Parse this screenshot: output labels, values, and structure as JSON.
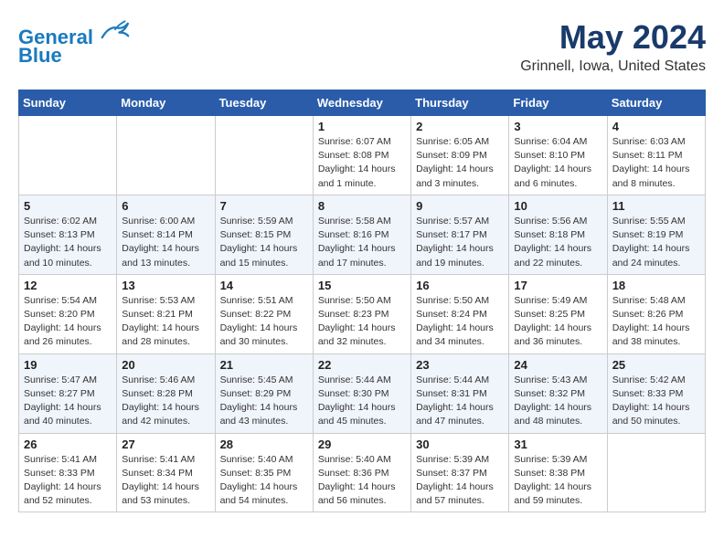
{
  "header": {
    "logo_line1": "General",
    "logo_line2": "Blue",
    "month_year": "May 2024",
    "location": "Grinnell, Iowa, United States"
  },
  "weekdays": [
    "Sunday",
    "Monday",
    "Tuesday",
    "Wednesday",
    "Thursday",
    "Friday",
    "Saturday"
  ],
  "weeks": [
    [
      {
        "day": "",
        "info": ""
      },
      {
        "day": "",
        "info": ""
      },
      {
        "day": "",
        "info": ""
      },
      {
        "day": "1",
        "info": "Sunrise: 6:07 AM\nSunset: 8:08 PM\nDaylight: 14 hours\nand 1 minute."
      },
      {
        "day": "2",
        "info": "Sunrise: 6:05 AM\nSunset: 8:09 PM\nDaylight: 14 hours\nand 3 minutes."
      },
      {
        "day": "3",
        "info": "Sunrise: 6:04 AM\nSunset: 8:10 PM\nDaylight: 14 hours\nand 6 minutes."
      },
      {
        "day": "4",
        "info": "Sunrise: 6:03 AM\nSunset: 8:11 PM\nDaylight: 14 hours\nand 8 minutes."
      }
    ],
    [
      {
        "day": "5",
        "info": "Sunrise: 6:02 AM\nSunset: 8:13 PM\nDaylight: 14 hours\nand 10 minutes."
      },
      {
        "day": "6",
        "info": "Sunrise: 6:00 AM\nSunset: 8:14 PM\nDaylight: 14 hours\nand 13 minutes."
      },
      {
        "day": "7",
        "info": "Sunrise: 5:59 AM\nSunset: 8:15 PM\nDaylight: 14 hours\nand 15 minutes."
      },
      {
        "day": "8",
        "info": "Sunrise: 5:58 AM\nSunset: 8:16 PM\nDaylight: 14 hours\nand 17 minutes."
      },
      {
        "day": "9",
        "info": "Sunrise: 5:57 AM\nSunset: 8:17 PM\nDaylight: 14 hours\nand 19 minutes."
      },
      {
        "day": "10",
        "info": "Sunrise: 5:56 AM\nSunset: 8:18 PM\nDaylight: 14 hours\nand 22 minutes."
      },
      {
        "day": "11",
        "info": "Sunrise: 5:55 AM\nSunset: 8:19 PM\nDaylight: 14 hours\nand 24 minutes."
      }
    ],
    [
      {
        "day": "12",
        "info": "Sunrise: 5:54 AM\nSunset: 8:20 PM\nDaylight: 14 hours\nand 26 minutes."
      },
      {
        "day": "13",
        "info": "Sunrise: 5:53 AM\nSunset: 8:21 PM\nDaylight: 14 hours\nand 28 minutes."
      },
      {
        "day": "14",
        "info": "Sunrise: 5:51 AM\nSunset: 8:22 PM\nDaylight: 14 hours\nand 30 minutes."
      },
      {
        "day": "15",
        "info": "Sunrise: 5:50 AM\nSunset: 8:23 PM\nDaylight: 14 hours\nand 32 minutes."
      },
      {
        "day": "16",
        "info": "Sunrise: 5:50 AM\nSunset: 8:24 PM\nDaylight: 14 hours\nand 34 minutes."
      },
      {
        "day": "17",
        "info": "Sunrise: 5:49 AM\nSunset: 8:25 PM\nDaylight: 14 hours\nand 36 minutes."
      },
      {
        "day": "18",
        "info": "Sunrise: 5:48 AM\nSunset: 8:26 PM\nDaylight: 14 hours\nand 38 minutes."
      }
    ],
    [
      {
        "day": "19",
        "info": "Sunrise: 5:47 AM\nSunset: 8:27 PM\nDaylight: 14 hours\nand 40 minutes."
      },
      {
        "day": "20",
        "info": "Sunrise: 5:46 AM\nSunset: 8:28 PM\nDaylight: 14 hours\nand 42 minutes."
      },
      {
        "day": "21",
        "info": "Sunrise: 5:45 AM\nSunset: 8:29 PM\nDaylight: 14 hours\nand 43 minutes."
      },
      {
        "day": "22",
        "info": "Sunrise: 5:44 AM\nSunset: 8:30 PM\nDaylight: 14 hours\nand 45 minutes."
      },
      {
        "day": "23",
        "info": "Sunrise: 5:44 AM\nSunset: 8:31 PM\nDaylight: 14 hours\nand 47 minutes."
      },
      {
        "day": "24",
        "info": "Sunrise: 5:43 AM\nSunset: 8:32 PM\nDaylight: 14 hours\nand 48 minutes."
      },
      {
        "day": "25",
        "info": "Sunrise: 5:42 AM\nSunset: 8:33 PM\nDaylight: 14 hours\nand 50 minutes."
      }
    ],
    [
      {
        "day": "26",
        "info": "Sunrise: 5:41 AM\nSunset: 8:33 PM\nDaylight: 14 hours\nand 52 minutes."
      },
      {
        "day": "27",
        "info": "Sunrise: 5:41 AM\nSunset: 8:34 PM\nDaylight: 14 hours\nand 53 minutes."
      },
      {
        "day": "28",
        "info": "Sunrise: 5:40 AM\nSunset: 8:35 PM\nDaylight: 14 hours\nand 54 minutes."
      },
      {
        "day": "29",
        "info": "Sunrise: 5:40 AM\nSunset: 8:36 PM\nDaylight: 14 hours\nand 56 minutes."
      },
      {
        "day": "30",
        "info": "Sunrise: 5:39 AM\nSunset: 8:37 PM\nDaylight: 14 hours\nand 57 minutes."
      },
      {
        "day": "31",
        "info": "Sunrise: 5:39 AM\nSunset: 8:38 PM\nDaylight: 14 hours\nand 59 minutes."
      },
      {
        "day": "",
        "info": ""
      }
    ]
  ]
}
